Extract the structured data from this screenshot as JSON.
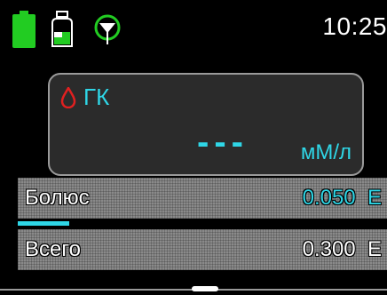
{
  "status_bar": {
    "battery_icon": "battery-full-icon",
    "reservoir_icon": "insulin-reservoir-icon",
    "signal_icon": "antenna-signal-icon",
    "time": "10:25"
  },
  "glucose_card": {
    "drop_icon": "blood-drop-icon",
    "label": "ГК",
    "value": "---",
    "unit": "мМ/л"
  },
  "rows": {
    "bolus": {
      "label": "Болюс",
      "value": "0.050  Е"
    },
    "total": {
      "label": "Всего",
      "value": "0.300  Е"
    }
  },
  "bolus_progress": 0.14,
  "colors": {
    "accent": "#2fd6e6",
    "battery": "#22cc22",
    "drop": "#e02020",
    "signal": "#22cc22"
  }
}
